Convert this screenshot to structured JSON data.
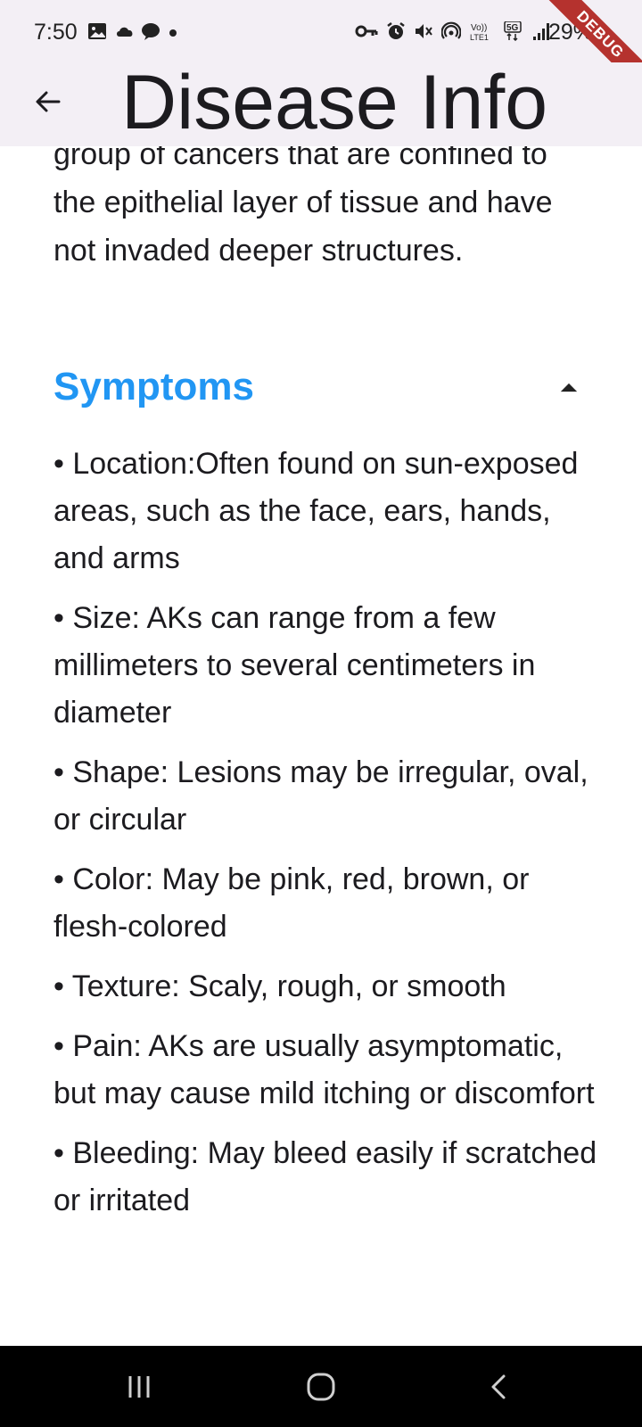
{
  "status_bar": {
    "time": "7:50",
    "battery": "29%",
    "left_icons": [
      "gallery-icon",
      "cloud-icon",
      "chat-bubble-icon",
      "dot-icon"
    ],
    "right_icons": [
      "vpn-key-icon",
      "alarm-icon",
      "mute-icon",
      "hotspot-icon",
      "volte-icon",
      "5g-icon",
      "signal-icon"
    ]
  },
  "debug_banner": "DEBUG",
  "app_bar": {
    "title": "Disease Info",
    "back_icon": "arrow-back-icon"
  },
  "intro": {
    "text": "group of cancers that are confined to the epithelial layer of tissue and have not invaded deeper structures."
  },
  "symptoms": {
    "title": "Symptoms",
    "accent_color": "#2196f3",
    "items": [
      "• Location:Often found on sun-exposed areas, such as the face, ears, hands, and arms",
      "• Size: AKs can range from a few millimeters to several centimeters in diameter",
      "• Shape: Lesions may be irregular, oval, or circular",
      "• Color: May be pink, red, brown, or flesh-colored",
      "• Texture: Scaly, rough, or smooth",
      "• Pain: AKs are usually asymptomatic, but may cause mild itching or discomfort",
      "• Bleeding: May bleed easily if scratched or irritated"
    ]
  },
  "nav_bar": {
    "buttons": [
      "recent-apps-icon",
      "home-icon",
      "back-icon"
    ]
  }
}
